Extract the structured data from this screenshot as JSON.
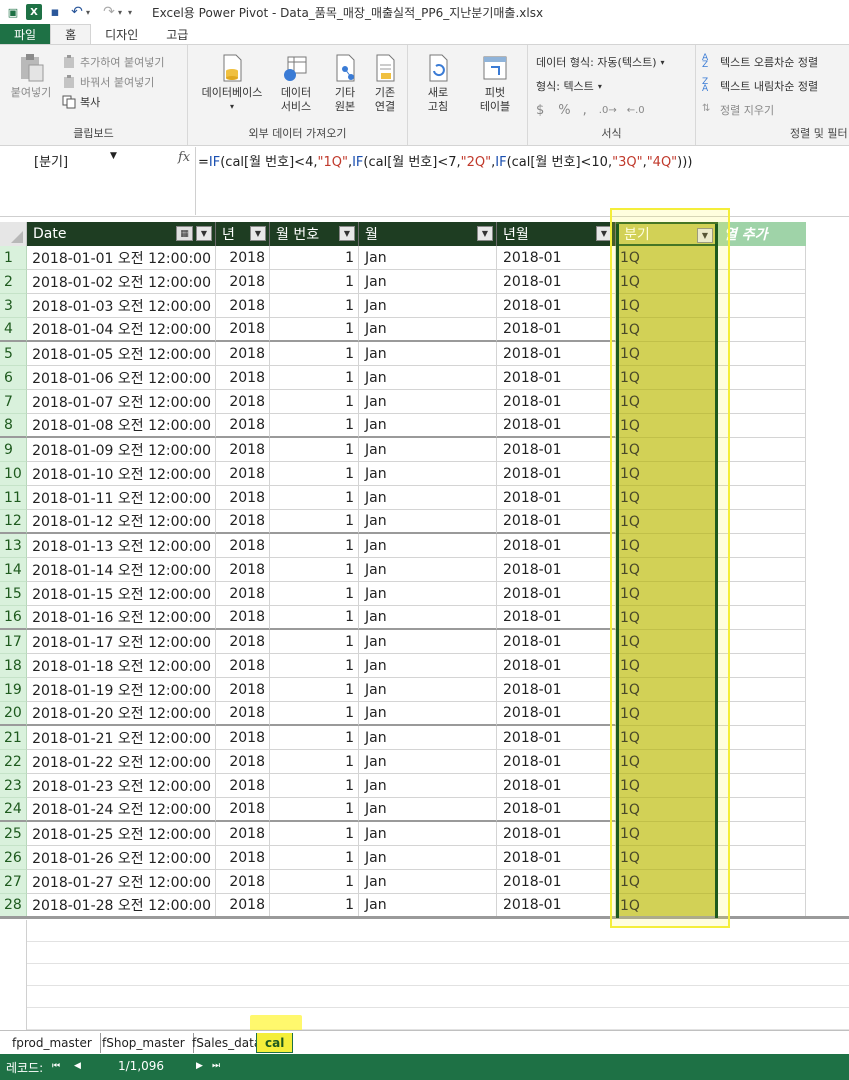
{
  "title_bar": {
    "title": "Excel용 Power Pivot - Data_품목_매장_매출실적_PP6_지난분기매출.xlsx"
  },
  "tabs": [
    {
      "label": "파일"
    },
    {
      "label": "홈"
    },
    {
      "label": "디자인"
    },
    {
      "label": "고급"
    }
  ],
  "ribbon": {
    "clipboard": {
      "paste": "붙여넣기",
      "append_paste": "추가하여 붙여넣기",
      "replace_paste": "바꿔서 붙여넣기",
      "copy": "복사",
      "group": "클립보드"
    },
    "external": {
      "database_1": "데이터베이스",
      "data_service_1": "데이터",
      "data_service_2": "서비스",
      "other_1": "기타",
      "other_2": "원본",
      "existing_1": "기존",
      "existing_2": "연결",
      "group": "외부 데이터 가져오기"
    },
    "refresh_1": "새로",
    "refresh_2": "고침",
    "pivot_1": "피벗",
    "pivot_2": "테이블",
    "format": {
      "data_format": "데이터 형식: 자동(텍스트)",
      "format": "형식: 텍스트",
      "currency": "$",
      "percent": "%",
      "comma": ",",
      "group": "서식"
    },
    "sort": {
      "asc": "텍스트 오름차순 정렬",
      "desc": "텍스트 내림차순 정렬",
      "clear": "정렬 지우기",
      "group": "정렬 및 필터"
    }
  },
  "formula_bar": {
    "name_box": "[분기]",
    "fx": "fx",
    "formula_parts": [
      "=",
      "IF",
      "(cal[월 번호]<4,",
      "\"1Q\"",
      ",",
      "IF",
      "(cal[월 번호]<7,",
      "\"2Q\"",
      ",",
      "IF",
      "(cal[월 번호]<10,",
      "\"3Q\"",
      ",",
      "\"4Q\"",
      ")))"
    ]
  },
  "columns": [
    "Date",
    "년",
    "월 번호",
    "월",
    "년월",
    "분기",
    "열 추가"
  ],
  "rows": [
    {
      "n": "1",
      "date": "2018-01-01 오전 12:00:00",
      "year": "2018",
      "month_no": "1",
      "month": "Jan",
      "ym": "2018-01",
      "quarter": "1Q"
    },
    {
      "n": "2",
      "date": "2018-01-02 오전 12:00:00",
      "year": "2018",
      "month_no": "1",
      "month": "Jan",
      "ym": "2018-01",
      "quarter": "1Q"
    },
    {
      "n": "3",
      "date": "2018-01-03 오전 12:00:00",
      "year": "2018",
      "month_no": "1",
      "month": "Jan",
      "ym": "2018-01",
      "quarter": "1Q"
    },
    {
      "n": "4",
      "date": "2018-01-04 오전 12:00:00",
      "year": "2018",
      "month_no": "1",
      "month": "Jan",
      "ym": "2018-01",
      "quarter": "1Q"
    },
    {
      "n": "5",
      "date": "2018-01-05 오전 12:00:00",
      "year": "2018",
      "month_no": "1",
      "month": "Jan",
      "ym": "2018-01",
      "quarter": "1Q"
    },
    {
      "n": "6",
      "date": "2018-01-06 오전 12:00:00",
      "year": "2018",
      "month_no": "1",
      "month": "Jan",
      "ym": "2018-01",
      "quarter": "1Q"
    },
    {
      "n": "7",
      "date": "2018-01-07 오전 12:00:00",
      "year": "2018",
      "month_no": "1",
      "month": "Jan",
      "ym": "2018-01",
      "quarter": "1Q"
    },
    {
      "n": "8",
      "date": "2018-01-08 오전 12:00:00",
      "year": "2018",
      "month_no": "1",
      "month": "Jan",
      "ym": "2018-01",
      "quarter": "1Q"
    },
    {
      "n": "9",
      "date": "2018-01-09 오전 12:00:00",
      "year": "2018",
      "month_no": "1",
      "month": "Jan",
      "ym": "2018-01",
      "quarter": "1Q"
    },
    {
      "n": "10",
      "date": "2018-01-10 오전 12:00:00",
      "year": "2018",
      "month_no": "1",
      "month": "Jan",
      "ym": "2018-01",
      "quarter": "1Q"
    },
    {
      "n": "11",
      "date": "2018-01-11 오전 12:00:00",
      "year": "2018",
      "month_no": "1",
      "month": "Jan",
      "ym": "2018-01",
      "quarter": "1Q"
    },
    {
      "n": "12",
      "date": "2018-01-12 오전 12:00:00",
      "year": "2018",
      "month_no": "1",
      "month": "Jan",
      "ym": "2018-01",
      "quarter": "1Q"
    },
    {
      "n": "13",
      "date": "2018-01-13 오전 12:00:00",
      "year": "2018",
      "month_no": "1",
      "month": "Jan",
      "ym": "2018-01",
      "quarter": "1Q"
    },
    {
      "n": "14",
      "date": "2018-01-14 오전 12:00:00",
      "year": "2018",
      "month_no": "1",
      "month": "Jan",
      "ym": "2018-01",
      "quarter": "1Q"
    },
    {
      "n": "15",
      "date": "2018-01-15 오전 12:00:00",
      "year": "2018",
      "month_no": "1",
      "month": "Jan",
      "ym": "2018-01",
      "quarter": "1Q"
    },
    {
      "n": "16",
      "date": "2018-01-16 오전 12:00:00",
      "year": "2018",
      "month_no": "1",
      "month": "Jan",
      "ym": "2018-01",
      "quarter": "1Q"
    },
    {
      "n": "17",
      "date": "2018-01-17 오전 12:00:00",
      "year": "2018",
      "month_no": "1",
      "month": "Jan",
      "ym": "2018-01",
      "quarter": "1Q"
    },
    {
      "n": "18",
      "date": "2018-01-18 오전 12:00:00",
      "year": "2018",
      "month_no": "1",
      "month": "Jan",
      "ym": "2018-01",
      "quarter": "1Q"
    },
    {
      "n": "19",
      "date": "2018-01-19 오전 12:00:00",
      "year": "2018",
      "month_no": "1",
      "month": "Jan",
      "ym": "2018-01",
      "quarter": "1Q"
    },
    {
      "n": "20",
      "date": "2018-01-20 오전 12:00:00",
      "year": "2018",
      "month_no": "1",
      "month": "Jan",
      "ym": "2018-01",
      "quarter": "1Q"
    },
    {
      "n": "21",
      "date": "2018-01-21 오전 12:00:00",
      "year": "2018",
      "month_no": "1",
      "month": "Jan",
      "ym": "2018-01",
      "quarter": "1Q"
    },
    {
      "n": "22",
      "date": "2018-01-22 오전 12:00:00",
      "year": "2018",
      "month_no": "1",
      "month": "Jan",
      "ym": "2018-01",
      "quarter": "1Q"
    },
    {
      "n": "23",
      "date": "2018-01-23 오전 12:00:00",
      "year": "2018",
      "month_no": "1",
      "month": "Jan",
      "ym": "2018-01",
      "quarter": "1Q"
    },
    {
      "n": "24",
      "date": "2018-01-24 오전 12:00:00",
      "year": "2018",
      "month_no": "1",
      "month": "Jan",
      "ym": "2018-01",
      "quarter": "1Q"
    },
    {
      "n": "25",
      "date": "2018-01-25 오전 12:00:00",
      "year": "2018",
      "month_no": "1",
      "month": "Jan",
      "ym": "2018-01",
      "quarter": "1Q"
    },
    {
      "n": "26",
      "date": "2018-01-26 오전 12:00:00",
      "year": "2018",
      "month_no": "1",
      "month": "Jan",
      "ym": "2018-01",
      "quarter": "1Q"
    },
    {
      "n": "27",
      "date": "2018-01-27 오전 12:00:00",
      "year": "2018",
      "month_no": "1",
      "month": "Jan",
      "ym": "2018-01",
      "quarter": "1Q"
    },
    {
      "n": "28",
      "date": "2018-01-28 오전 12:00:00",
      "year": "2018",
      "month_no": "1",
      "month": "Jan",
      "ym": "2018-01",
      "quarter": "1Q"
    }
  ],
  "sheet_tabs": [
    {
      "label": "fprod_master"
    },
    {
      "label": "fShop_master"
    },
    {
      "label": "fSales_data"
    },
    {
      "label": "cal"
    }
  ],
  "status_bar": {
    "records_label": "레코드:",
    "position": "1/1,096"
  },
  "colors": {
    "excel_green": "#1e7145",
    "header_dark": "#1e3d22",
    "selected_column": "#c8c85a",
    "highlight": "#f4ee3a",
    "rownum_bg": "#d9f1dc"
  }
}
